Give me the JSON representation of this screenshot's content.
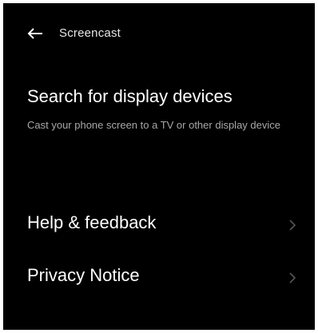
{
  "header": {
    "back_icon": "arrow-left-icon",
    "title": "Screencast"
  },
  "items": {
    "search": {
      "title": "Search for display devices",
      "description": "Cast your phone screen to a TV or other display device"
    },
    "help": {
      "title": "Help & feedback",
      "icon": "chevron-right-icon"
    },
    "privacy": {
      "title": "Privacy Notice",
      "icon": "chevron-right-icon"
    }
  },
  "colors": {
    "background": "#000000",
    "text_primary": "#ffffff",
    "text_secondary": "#a8a8a8",
    "chevron": "#555555"
  }
}
